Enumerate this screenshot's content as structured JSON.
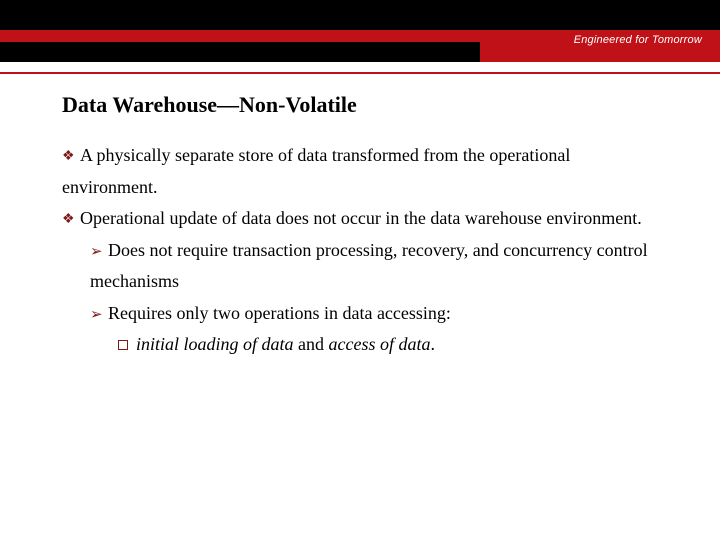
{
  "header": {
    "tagline": "Engineered for Tomorrow"
  },
  "slide": {
    "title": "Data Warehouse—Non-Volatile",
    "b1": "A physically separate store of data transformed from the operational environment.",
    "b2": "Operational update of data does not occur in the data warehouse environment.",
    "b2_1": "Does not require transaction processing, recovery, and concurrency control mechanisms",
    "b2_2": "Requires only two operations in data accessing:",
    "b2_2_1_pre": "initial loading of data",
    "b2_2_1_mid": " and ",
    "b2_2_1_post": "access of data",
    "b2_2_1_end": "."
  }
}
